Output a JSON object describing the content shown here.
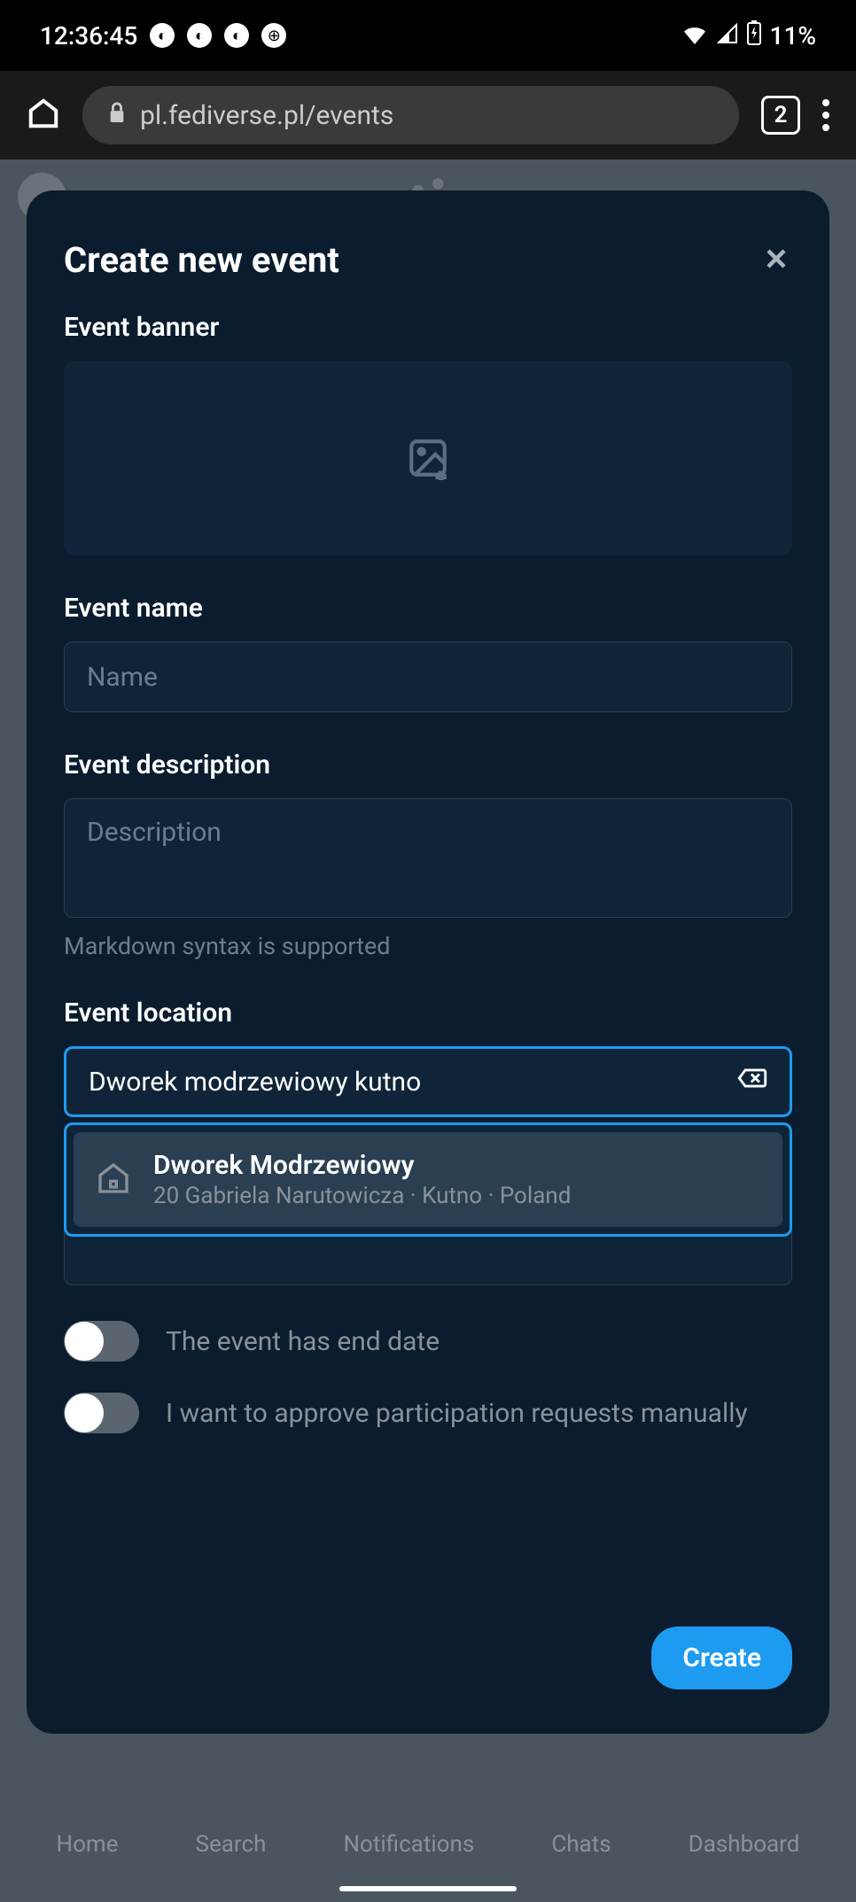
{
  "status": {
    "time": "12:36:45",
    "battery": "11%"
  },
  "browser": {
    "url": "pl.fediverse.pl/events",
    "tab_count": "2"
  },
  "modal": {
    "title": "Create new event",
    "banner_label": "Event banner",
    "name_label": "Event name",
    "name_placeholder": "Name",
    "description_label": "Event description",
    "description_placeholder": "Description",
    "description_helper": "Markdown syntax is supported",
    "location_label": "Event location",
    "location_value": "Dworek modrzewiowy kutno",
    "suggestion": {
      "title": "Dworek Modrzewiowy",
      "subtitle": "20 Gabriela Narutowicza · Kutno · Poland"
    },
    "toggle_end_date": "The event has end date",
    "toggle_approval": "I want to approve participation requests manually",
    "create_button": "Create"
  },
  "nav": {
    "home": "Home",
    "search": "Search",
    "notifications": "Notifications",
    "chats": "Chats",
    "dashboard": "Dashboard"
  }
}
